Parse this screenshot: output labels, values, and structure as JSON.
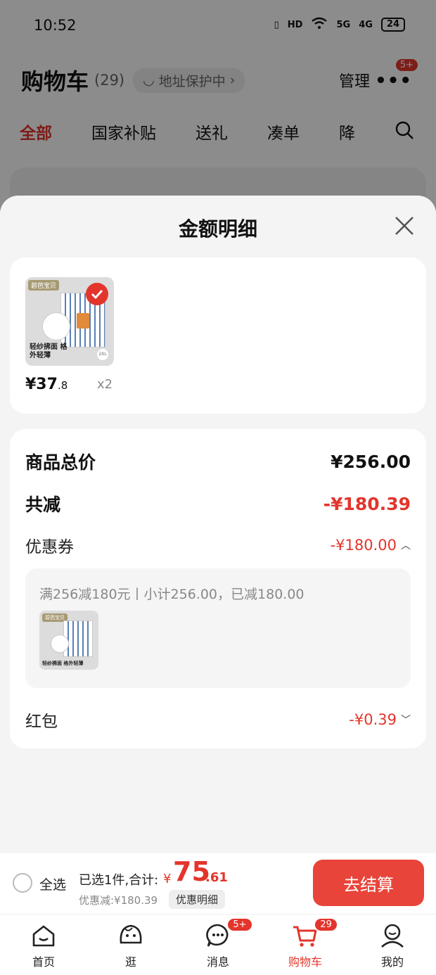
{
  "status_bar": {
    "time": "10:52",
    "hd": "HD",
    "net1": "5G",
    "net2": "4G",
    "battery": "24"
  },
  "cart_header": {
    "title": "购物车",
    "count": "(29)",
    "address_protect": "地址保护中",
    "manage": "管理",
    "more_badge": "5+"
  },
  "category_tabs": [
    {
      "label": "全部",
      "active": true
    },
    {
      "label": "国家补贴"
    },
    {
      "label": "送礼"
    },
    {
      "label": "凑单"
    },
    {
      "label": "降"
    }
  ],
  "sheet": {
    "title": "金额明细",
    "products": [
      {
        "thumb_tag": "碧芭宝贝",
        "thumb_text": "轻纱拂面 格外轻薄",
        "thumb_size": "2XL",
        "price_int": "¥37",
        "price_dec": ".8",
        "qty": "x2"
      }
    ],
    "summary": {
      "total_label": "商品总价",
      "total_value": "¥256.00",
      "reduce_label": "共减",
      "reduce_value": "-¥180.39",
      "coupon_label": "优惠券",
      "coupon_value": "-¥180.00",
      "coupon_desc": "满256减180元丨小计256.00，已减180.00",
      "redpacket_label": "红包",
      "redpacket_value": "-¥0.39"
    }
  },
  "checkout": {
    "select_all": "全选",
    "selected_info": "已选1件,合计:",
    "currency": "¥",
    "total_int": "75",
    "total_dec": ".61",
    "discount_info": "优惠减:¥180.39",
    "detail_button": "优惠明细",
    "checkout_button": "去结算"
  },
  "tab_bar": [
    {
      "label": "首页",
      "icon": "home-icon"
    },
    {
      "label": "逛",
      "icon": "browse-icon"
    },
    {
      "label": "消息",
      "icon": "message-icon",
      "badge": "5+"
    },
    {
      "label": "购物车",
      "icon": "cart-icon",
      "badge": "29",
      "active": true
    },
    {
      "label": "我的",
      "icon": "profile-icon"
    }
  ],
  "colors": {
    "accent": "#e3352c",
    "checkout_button": "#e8443a"
  }
}
